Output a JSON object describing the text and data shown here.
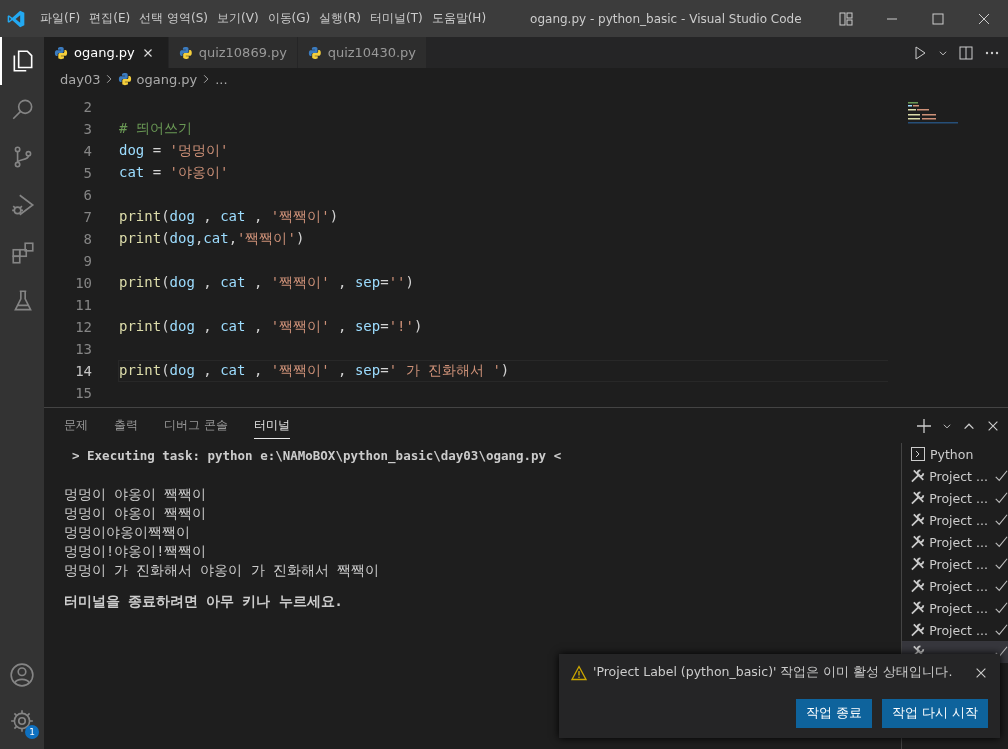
{
  "window": {
    "title": "ogang.py - python_basic - Visual Studio Code"
  },
  "menu": [
    "파일(F)",
    "편집(E)",
    "선택 영역(S)",
    "보기(V)",
    "이동(G)",
    "실행(R)",
    "터미널(T)",
    "도움말(H)"
  ],
  "activity_bar": {
    "items": [
      {
        "kind": "explorer",
        "selected": true
      },
      {
        "kind": "search",
        "selected": false
      },
      {
        "kind": "source-control",
        "selected": false
      },
      {
        "kind": "run-debug",
        "selected": false
      },
      {
        "kind": "extensions",
        "selected": false
      },
      {
        "kind": "testing",
        "selected": false
      }
    ],
    "settings_badge": "1"
  },
  "tabs": [
    {
      "label": "ogang.py",
      "selected": true
    },
    {
      "label": "quiz10869.py",
      "selected": false
    },
    {
      "label": "quiz10430.py",
      "selected": false
    }
  ],
  "breadcrumb": [
    "day03",
    "ogang.py",
    "..."
  ],
  "editor": {
    "lines": [
      {
        "number": "2",
        "current": false
      },
      {
        "number": "3",
        "current": false,
        "tokens": [
          {
            "kind": "comment",
            "text": "# 띄어쓰기"
          }
        ]
      },
      {
        "number": "4",
        "current": false,
        "tokens": [
          {
            "kind": "var",
            "text": "dog"
          },
          {
            "kind": "op",
            "text": " = "
          },
          {
            "kind": "str",
            "text": "'멍멍이'"
          }
        ]
      },
      {
        "number": "5",
        "current": false,
        "tokens": [
          {
            "kind": "var",
            "text": "cat"
          },
          {
            "kind": "op",
            "text": " = "
          },
          {
            "kind": "str",
            "text": "'야옹이'"
          }
        ]
      },
      {
        "number": "6",
        "current": false
      },
      {
        "number": "7",
        "current": false,
        "tokens": [
          {
            "kind": "fn",
            "text": "print"
          },
          {
            "kind": "op",
            "text": "("
          },
          {
            "kind": "var",
            "text": "dog"
          },
          {
            "kind": "op",
            "text": " , "
          },
          {
            "kind": "var",
            "text": "cat"
          },
          {
            "kind": "op",
            "text": " , "
          },
          {
            "kind": "str",
            "text": "'짹짹이'"
          },
          {
            "kind": "op",
            "text": ")"
          }
        ]
      },
      {
        "number": "8",
        "current": false,
        "tokens": [
          {
            "kind": "fn",
            "text": "print"
          },
          {
            "kind": "op",
            "text": "("
          },
          {
            "kind": "var",
            "text": "dog"
          },
          {
            "kind": "op",
            "text": ","
          },
          {
            "kind": "var",
            "text": "cat"
          },
          {
            "kind": "op",
            "text": ","
          },
          {
            "kind": "str",
            "text": "'짹짹이'"
          },
          {
            "kind": "op",
            "text": ")"
          }
        ]
      },
      {
        "number": "9",
        "current": false
      },
      {
        "number": "10",
        "current": false,
        "tokens": [
          {
            "kind": "fn",
            "text": "print"
          },
          {
            "kind": "op",
            "text": "("
          },
          {
            "kind": "var",
            "text": "dog"
          },
          {
            "kind": "op",
            "text": " , "
          },
          {
            "kind": "var",
            "text": "cat"
          },
          {
            "kind": "op",
            "text": " , "
          },
          {
            "kind": "str",
            "text": "'짹짹이'"
          },
          {
            "kind": "op",
            "text": " , "
          },
          {
            "kind": "var",
            "text": "sep"
          },
          {
            "kind": "op",
            "text": "="
          },
          {
            "kind": "str",
            "text": "''"
          },
          {
            "kind": "op",
            "text": ")"
          }
        ]
      },
      {
        "number": "11",
        "current": false
      },
      {
        "number": "12",
        "current": false,
        "tokens": [
          {
            "kind": "fn",
            "text": "print"
          },
          {
            "kind": "op",
            "text": "("
          },
          {
            "kind": "var",
            "text": "dog"
          },
          {
            "kind": "op",
            "text": " , "
          },
          {
            "kind": "var",
            "text": "cat"
          },
          {
            "kind": "op",
            "text": " , "
          },
          {
            "kind": "str",
            "text": "'짹짹이'"
          },
          {
            "kind": "op",
            "text": " , "
          },
          {
            "kind": "var",
            "text": "sep"
          },
          {
            "kind": "op",
            "text": "="
          },
          {
            "kind": "str",
            "text": "'!'"
          },
          {
            "kind": "op",
            "text": ")"
          }
        ]
      },
      {
        "number": "13",
        "current": false
      },
      {
        "number": "14",
        "current": true,
        "tokens": [
          {
            "kind": "fn",
            "text": "print"
          },
          {
            "kind": "op",
            "text": "("
          },
          {
            "kind": "var",
            "text": "dog"
          },
          {
            "kind": "op",
            "text": " , "
          },
          {
            "kind": "var",
            "text": "cat"
          },
          {
            "kind": "op",
            "text": " , "
          },
          {
            "kind": "str",
            "text": "'짹짹이'"
          },
          {
            "kind": "op",
            "text": " , "
          },
          {
            "kind": "var",
            "text": "sep"
          },
          {
            "kind": "op",
            "text": "="
          },
          {
            "kind": "str",
            "text": "' 가 진화해서 '"
          },
          {
            "kind": "op",
            "text": ")"
          }
        ]
      },
      {
        "number": "15",
        "current": false
      }
    ]
  },
  "panel": {
    "tabs": [
      {
        "label": "문제",
        "selected": false
      },
      {
        "label": "출력",
        "selected": false
      },
      {
        "label": "디버그 콘솔",
        "selected": false
      },
      {
        "label": "터미널",
        "selected": true
      }
    ],
    "terminal_lines": [
      {
        "kind": "task",
        "text": "> Executing task: python e:\\NAMoBOX\\python_basic\\day03\\ogang.py <"
      },
      {
        "kind": "output",
        "text": "멍멍이 야옹이 짹짹이"
      },
      {
        "kind": "output",
        "text": "멍멍이 야옹이 짹짹이"
      },
      {
        "kind": "output",
        "text": "멍멍이야옹이짹짹이"
      },
      {
        "kind": "output",
        "text": "멍멍이!야옹이!짹짹이"
      },
      {
        "kind": "output",
        "text": "멍멍이 가 진화해서 야옹이 가 진화해서 짹짹이"
      },
      {
        "kind": "prompt",
        "text": "터미널을 종료하려면 아무 키나 누르세요."
      }
    ],
    "task_list": [
      {
        "kind": "terminal",
        "label": "Python",
        "done": false,
        "selected": false
      },
      {
        "kind": "task",
        "label": "Project ...",
        "done": true,
        "selected": false
      },
      {
        "kind": "task",
        "label": "Project ...",
        "done": true,
        "selected": false
      },
      {
        "kind": "task",
        "label": "Project ...",
        "done": true,
        "selected": false
      },
      {
        "kind": "task",
        "label": "Project ...",
        "done": true,
        "selected": false
      },
      {
        "kind": "task",
        "label": "Project ...",
        "done": true,
        "selected": false
      },
      {
        "kind": "task",
        "label": "Project ...",
        "done": true,
        "selected": false
      },
      {
        "kind": "task",
        "label": "Project ...",
        "done": true,
        "selected": false
      },
      {
        "kind": "task",
        "label": "Project ...",
        "done": true,
        "selected": false
      },
      {
        "kind": "task",
        "done": true,
        "selected": true
      }
    ]
  },
  "notification": {
    "kind": "warning",
    "message": "'Project Label (python_basic)' 작업은 이미 활성 상태입니다.",
    "buttons": [
      "작업 종료",
      "작업 다시 시작"
    ]
  }
}
